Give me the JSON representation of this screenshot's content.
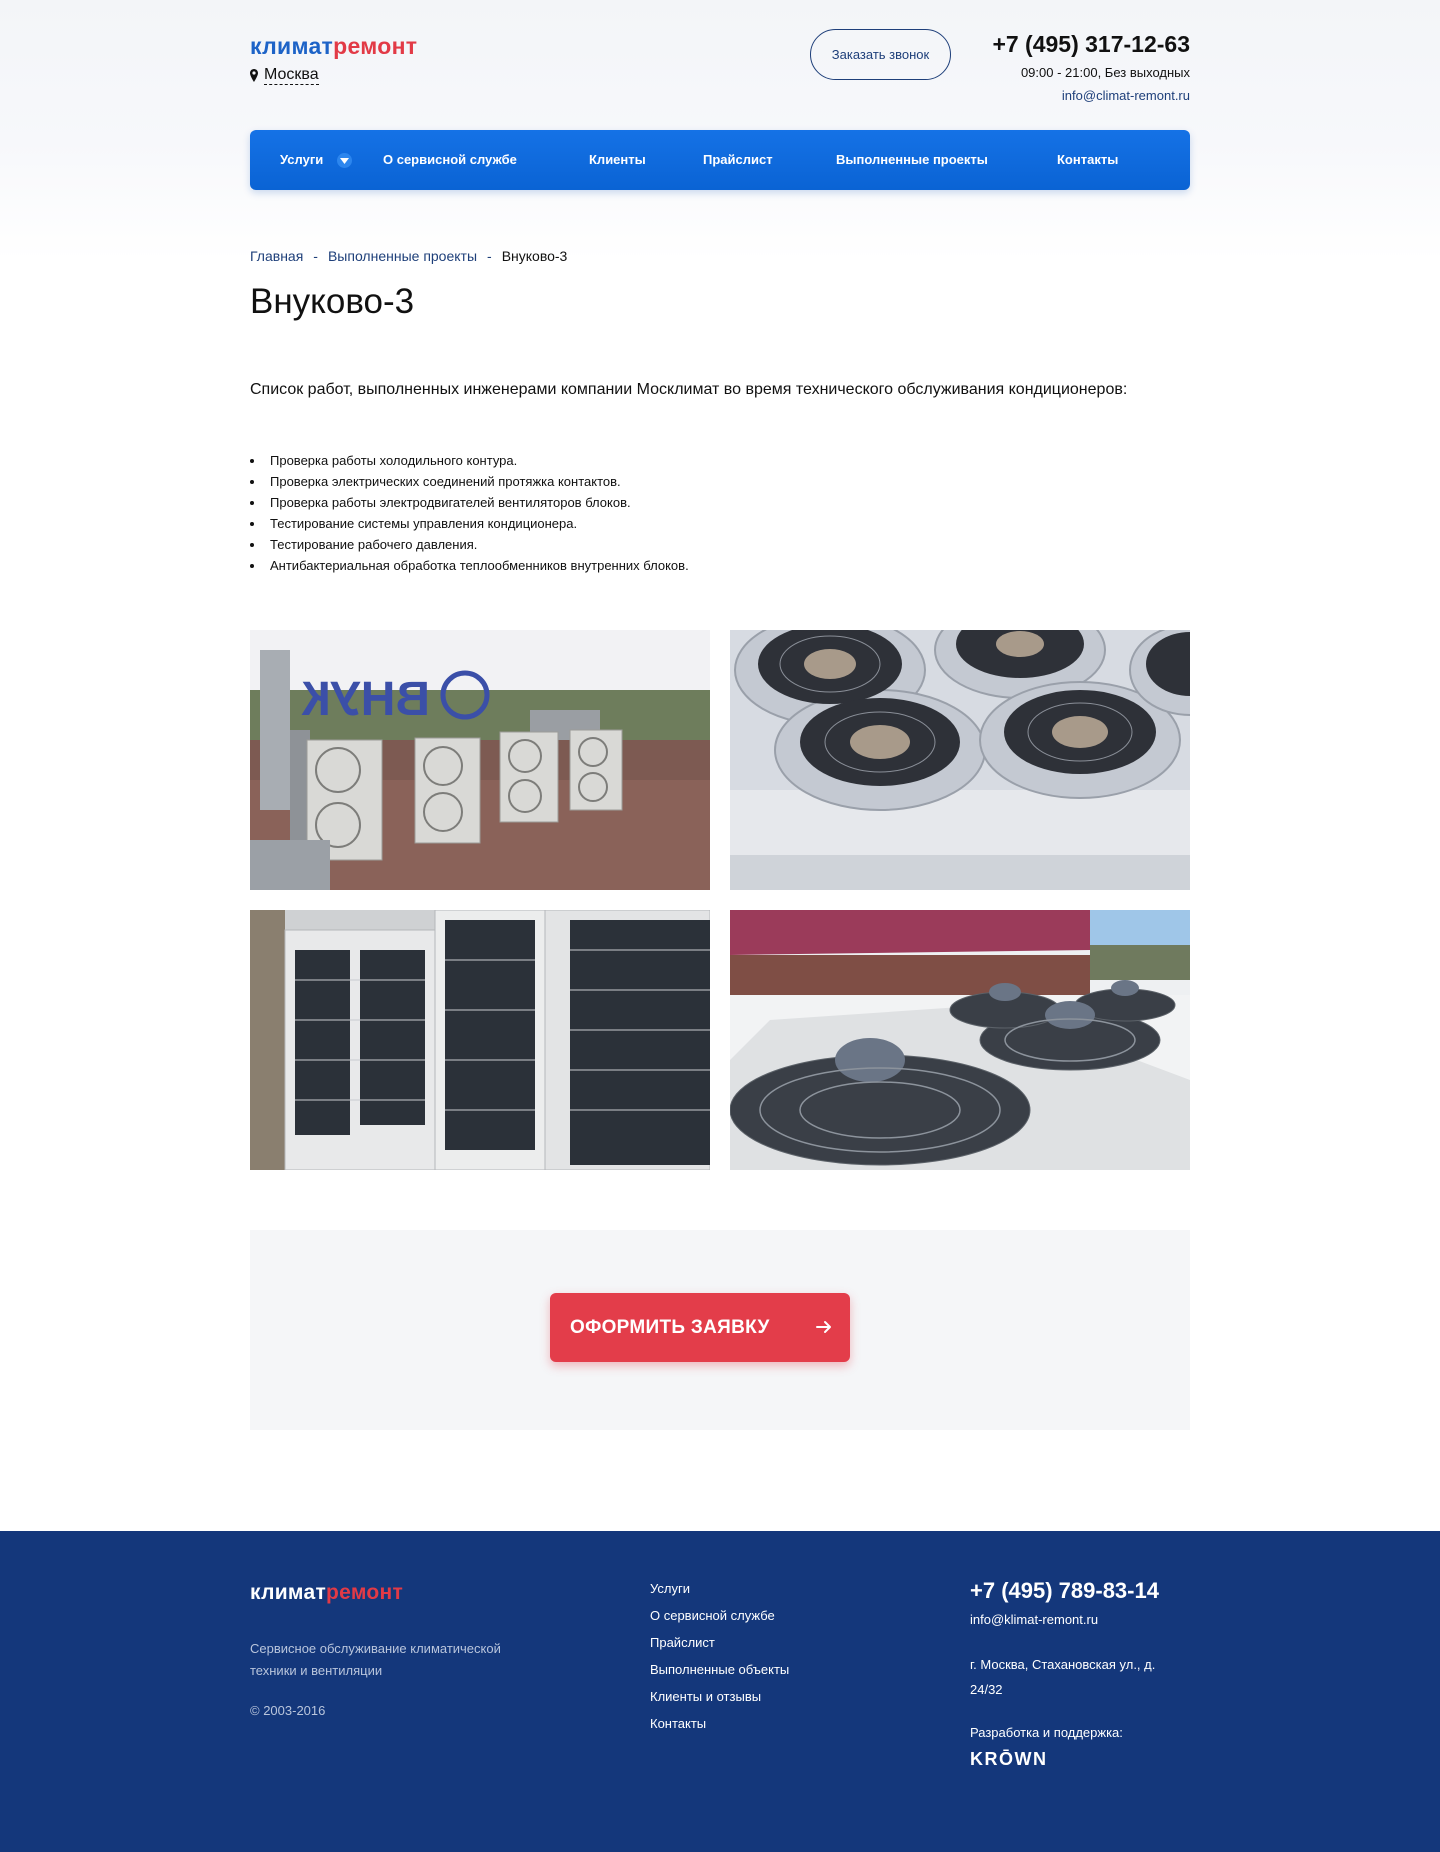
{
  "header": {
    "logo_part1": "климат",
    "logo_part2": "ремонт",
    "city": "Москва",
    "callback_label": "Заказать звонок",
    "phone": "+7 (495) 317-12-63",
    "hours": "09:00 - 21:00, Без выходных",
    "email": "info@climat-remont.ru"
  },
  "nav": {
    "items": [
      {
        "label": "Услуги"
      },
      {
        "label": "О сервисной службе"
      },
      {
        "label": "Клиенты"
      },
      {
        "label": "Прайслист"
      },
      {
        "label": "Выполненные проекты"
      },
      {
        "label": "Контакты"
      }
    ]
  },
  "breadcrumb": {
    "items": [
      "Главная",
      "Выполненные проекты",
      "Внуково-3"
    ],
    "separator": "-"
  },
  "page": {
    "title": "Внуково-3",
    "intro": "Список работ, выполненных инженерами компании Москлимат во время технического обслуживания кондиционеров:",
    "works": [
      "Проверка работы холодильного контура.",
      "Проверка электрических соединений протяжка контактов.",
      "Проверка работы электродвигателей вентиляторов блоков.",
      "Тестирование системы управления кондиционера.",
      "Тестирование рабочего давления.",
      "Антибактериальная обработка теплообменников внутренних блоков."
    ]
  },
  "cta": {
    "label": "ОФОРМИТЬ ЗАЯВКУ"
  },
  "footer": {
    "logo_part1": "климат",
    "logo_part2": "ремонт",
    "description": "Сервисное обслуживание климатической техники и вентиляции",
    "copyright": "© 2003-2016",
    "menu": [
      {
        "label": "Услуги"
      },
      {
        "label": "О сервисной службе"
      },
      {
        "label": "Прайслист"
      },
      {
        "label": "Выполненные объекты"
      },
      {
        "label": "Клиенты и отзывы"
      },
      {
        "label": "Контакты"
      }
    ],
    "phone": "+7 (495) 789-83-14",
    "email": "info@klimat-remont.ru",
    "address": "г. Москва, Стахановская ул., д. 24/32",
    "dev_label": "Разработка и поддержка:",
    "dev_brand": "KRŌWN"
  },
  "colors": {
    "brand_blue": "#1d63c7",
    "brand_red": "#e23a46",
    "nav_blue": "#0a63d4",
    "footer_navy": "#14377b",
    "cta_red": "#e33d4a"
  }
}
